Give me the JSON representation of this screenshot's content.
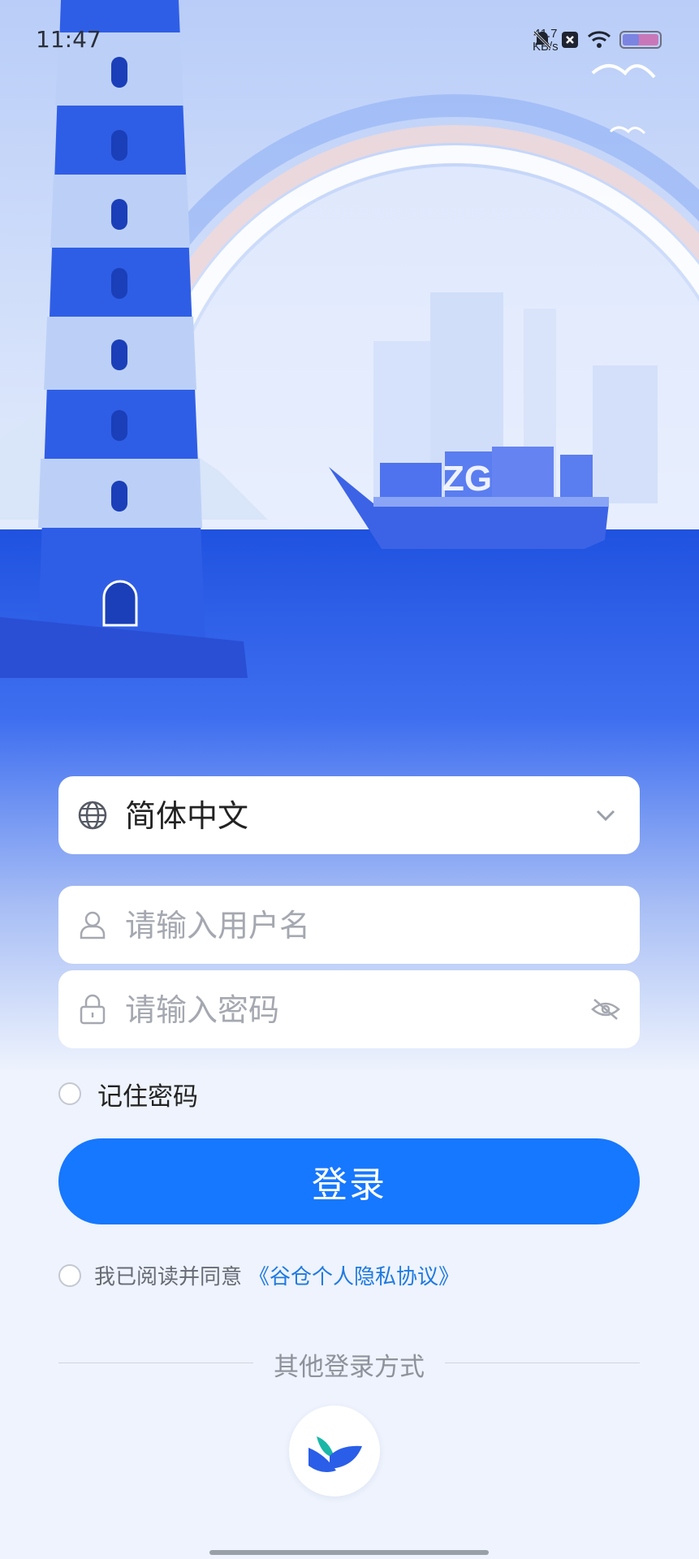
{
  "status_bar": {
    "time": "11:47",
    "net_speed": "41.7",
    "net_unit": "KB/s",
    "icons": [
      "bell-off-icon",
      "close-box-icon",
      "wifi-icon",
      "battery-icon"
    ]
  },
  "hero": {
    "illustration": "lighthouse-ship-harbor",
    "ship_logo": "ZG"
  },
  "language": {
    "value": "简体中文",
    "icon": "globe-icon",
    "chevron": "chevron-down-icon"
  },
  "username": {
    "placeholder": "请输入用户名",
    "icon": "user-icon"
  },
  "password": {
    "placeholder": "请输入密码",
    "icon": "lock-icon",
    "toggle_icon": "eye-off-icon"
  },
  "remember": {
    "label": "记住密码",
    "checked": false
  },
  "login_button": {
    "label": "登录",
    "color": "#1677ff"
  },
  "agreement": {
    "text": "我已阅读并同意",
    "link": "《谷仓个人隐私协议》",
    "checked": false,
    "link_color": "#1f7ae0"
  },
  "other_login": {
    "label": "其他登录方式",
    "icon": "bird-logo-icon"
  }
}
